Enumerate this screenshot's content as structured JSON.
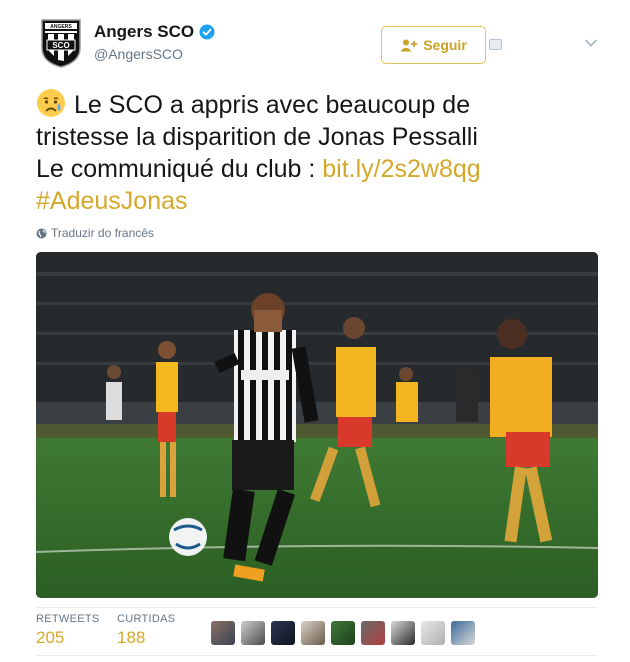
{
  "user": {
    "display_name": "Angers SCO",
    "handle": "@AngersSCO",
    "logo_text": "SCO",
    "logo_top_text": "ANGERS"
  },
  "actions": {
    "follow_label": "Seguir"
  },
  "tweet": {
    "line1": "Le SCO a appris avec beaucoup de",
    "line2": "tristesse la disparition de Jonas Pessalli",
    "line3_prefix": "Le communiqué du club : ",
    "link": "bit.ly/2s2w8qg",
    "hashtag": "#AdeusJonas",
    "emoji": "crying-face"
  },
  "translation": {
    "label": "Traduzir do francês"
  },
  "media": {
    "description_icon": "photo"
  },
  "stats": {
    "retweets_label": "RETWEETS",
    "retweets_value": "205",
    "likes_label": "CURTIDAS",
    "likes_value": "188"
  },
  "colors": {
    "accent": "#d4a82a",
    "follow_border": "#e2c45a",
    "muted": "#657786",
    "verified": "#1da1f2"
  }
}
